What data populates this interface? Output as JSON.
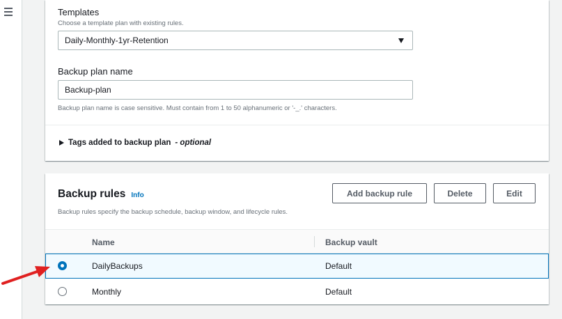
{
  "templates": {
    "label": "Templates",
    "description": "Choose a template plan with existing rules.",
    "selected": "Daily-Monthly-1yr-Retention"
  },
  "plan_name": {
    "label": "Backup plan name",
    "value": "Backup-plan",
    "hint": "Backup plan name is case sensitive. Must contain from 1 to 50 alphanumeric or '-_.' characters."
  },
  "tags": {
    "label": "Tags added to backup plan",
    "optional": "- optional"
  },
  "backup_rules": {
    "title": "Backup rules",
    "info": "Info",
    "description": "Backup rules specify the backup schedule, backup window, and lifecycle rules.",
    "buttons": {
      "add": "Add backup rule",
      "delete": "Delete",
      "edit": "Edit"
    },
    "columns": [
      "Name",
      "Backup vault"
    ],
    "rows": [
      {
        "name": "DailyBackups",
        "vault": "Default",
        "selected": true
      },
      {
        "name": "Monthly",
        "vault": "Default",
        "selected": false
      }
    ]
  },
  "colors": {
    "accent": "#0073bb",
    "annotation_arrow": "#e02020"
  }
}
